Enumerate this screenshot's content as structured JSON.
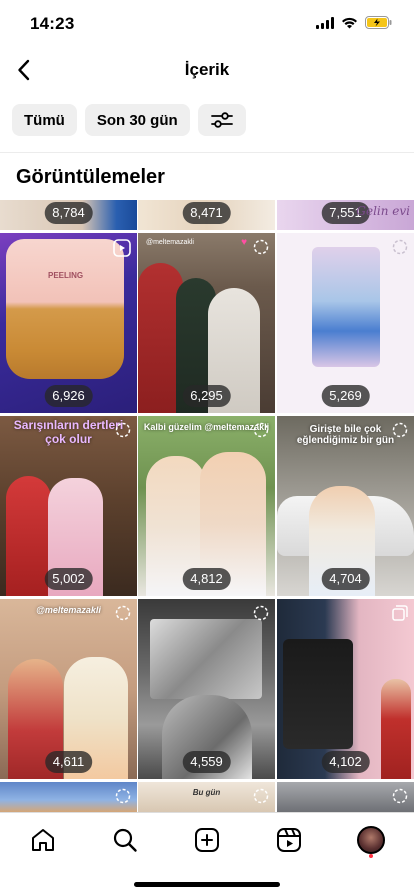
{
  "status_bar": {
    "time": "14:23"
  },
  "nav": {
    "title": "İçerik"
  },
  "filters": [
    {
      "label": "Tümü"
    },
    {
      "label": "Son 30 gün"
    }
  ],
  "section": {
    "title": "Görüntülemeler"
  },
  "tiles": [
    {
      "views": "8,784"
    },
    {
      "views": "8,471"
    },
    {
      "views": "7,551",
      "caption": "Gelin evi"
    },
    {
      "views": "6,926",
      "caption": "PEELING"
    },
    {
      "views": "6,295",
      "caption": "@meltemazakli"
    },
    {
      "views": "5,269"
    },
    {
      "views": "5,002",
      "caption": "Sarışınların dertleri çok olur"
    },
    {
      "views": "4,812",
      "caption": "Kalbi güzelim @meltemazakli"
    },
    {
      "views": "4,704",
      "caption": "Girişte bile çok eğlendiğimiz bir gün"
    },
    {
      "views": "4,611",
      "caption": "@meltemazakli"
    },
    {
      "views": "4,559"
    },
    {
      "views": "4,102"
    },
    {
      "caption": "Bu gün"
    }
  ],
  "colors": {
    "accent": "#ff3040",
    "chip_bg": "#efefef"
  },
  "icons": [
    "back-arrow-icon",
    "sliders-icon",
    "home-icon",
    "search-icon",
    "create-icon",
    "reels-icon",
    "profile-avatar-icon"
  ]
}
